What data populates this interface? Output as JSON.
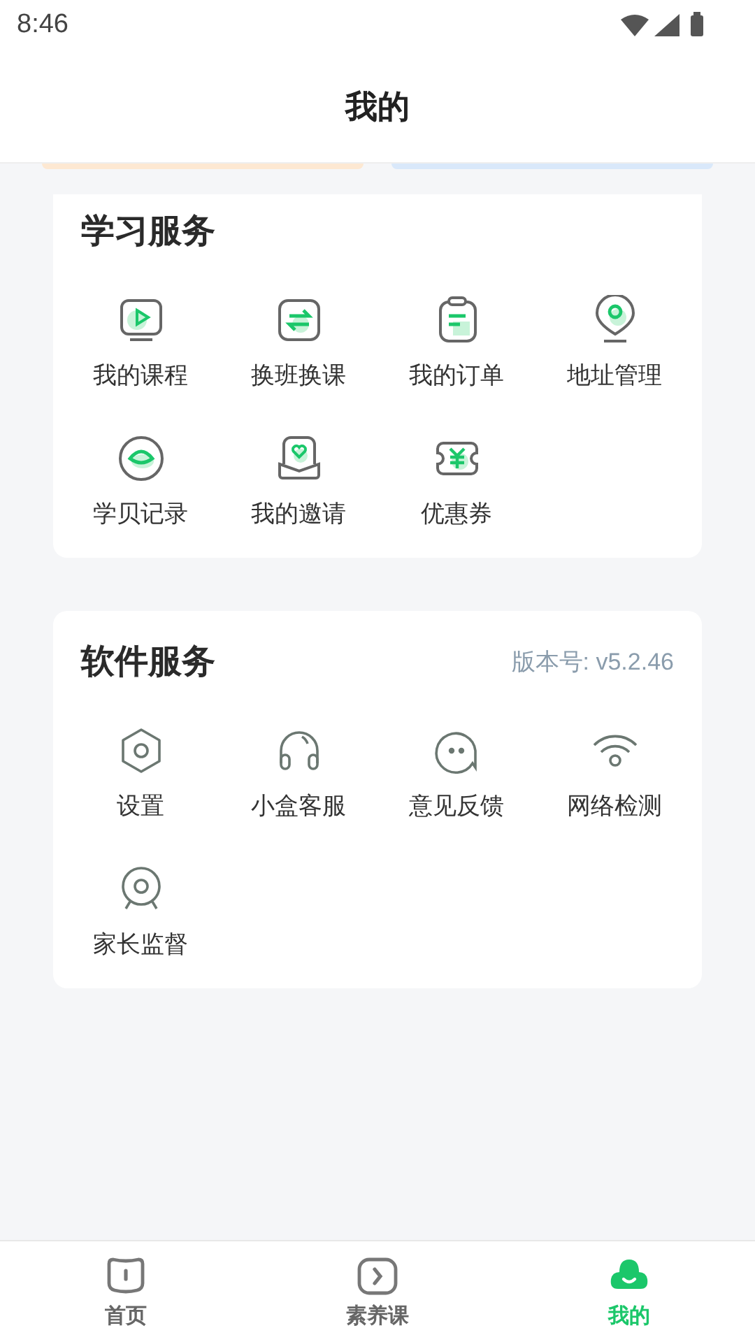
{
  "status_bar": {
    "time": "8:46"
  },
  "header": {
    "title": "我的"
  },
  "study_services": {
    "title": "学习服务",
    "items": [
      {
        "label": "我的课程",
        "kind": "course"
      },
      {
        "label": "换班换课",
        "kind": "swap"
      },
      {
        "label": "我的订单",
        "kind": "order"
      },
      {
        "label": "地址管理",
        "kind": "address"
      },
      {
        "label": "学贝记录",
        "kind": "shell"
      },
      {
        "label": "我的邀请",
        "kind": "invite"
      },
      {
        "label": "优惠券",
        "kind": "coupon"
      }
    ]
  },
  "software_services": {
    "title": "软件服务",
    "version": "版本号: v5.2.46",
    "items": [
      {
        "label": "设置",
        "kind": "settings"
      },
      {
        "label": "小盒客服",
        "kind": "headset"
      },
      {
        "label": "意见反馈",
        "kind": "chat"
      },
      {
        "label": "网络检测",
        "kind": "wifi"
      },
      {
        "label": "家长监督",
        "kind": "camera"
      }
    ]
  },
  "tab_bar": [
    {
      "label": "首页",
      "kind": "home",
      "selected": false
    },
    {
      "label": "素养课",
      "kind": "play",
      "selected": false
    },
    {
      "label": "我的",
      "kind": "cloud",
      "selected": true
    }
  ]
}
